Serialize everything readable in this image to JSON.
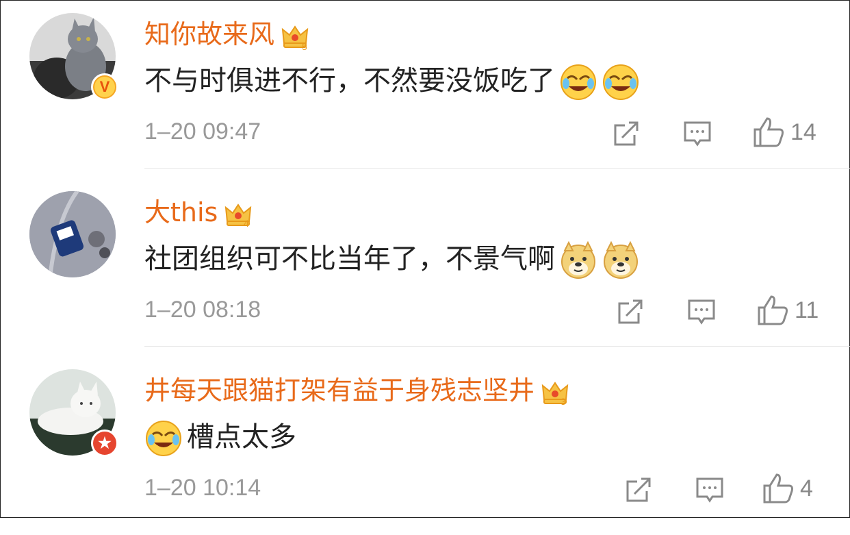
{
  "comments": [
    {
      "username": "知你故来风",
      "crown_level": "5",
      "text": "不与时俱进不行，不然要没饭吃了",
      "emoji_after": [
        "laugh-cry-emoji",
        "laugh-cry-emoji"
      ],
      "time": "1–20 09:47",
      "likes": "14",
      "badge": "V"
    },
    {
      "username": "大this",
      "crown_level": "4",
      "text": "社团组织可不比当年了，不景气啊",
      "emoji_after": [
        "doge-emoji",
        "doge-emoji"
      ],
      "time": "1–20 08:18",
      "likes": "11",
      "badge": ""
    },
    {
      "username": "井每天跟猫打架有益于身残志坚井",
      "crown_level": "3",
      "text": "槽点太多",
      "emoji_before": [
        "laugh-cry-emoji"
      ],
      "time": "1–20 10:14",
      "likes": "4",
      "badge": "★"
    }
  ],
  "colors": {
    "username": "#e86a1a",
    "text": "#222222",
    "meta": "#999999",
    "icon": "#8a8a8a",
    "divider": "#e6e6e6"
  }
}
